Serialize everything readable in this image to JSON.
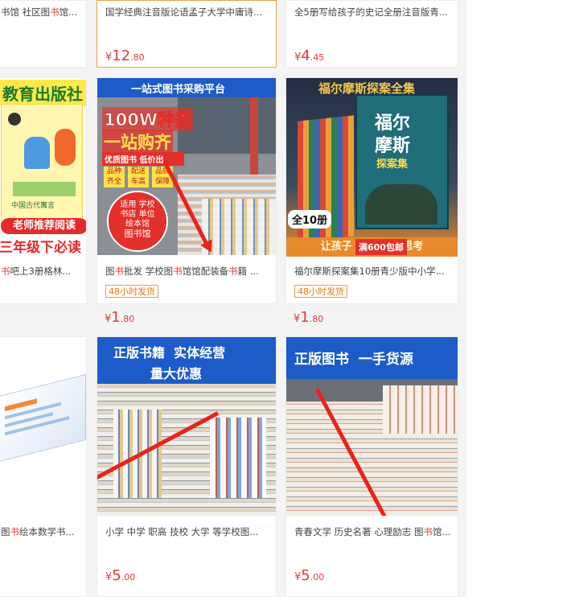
{
  "row1": {
    "left": {
      "title_pre": "书馆 社区图",
      "title_red": "书",
      "title_post": "馆..."
    },
    "mid": {
      "title": "国学经典注音版论语孟子大学中庸诗...",
      "price_yen": "¥",
      "price_int": "12",
      "price_dec": ".80"
    },
    "right": {
      "title": "全5册写给孩子的史记全册注音版青...",
      "price_yen": "¥",
      "price_int": "4",
      "price_dec": ".45"
    }
  },
  "row2": {
    "left": {
      "img_top": "教育出版社",
      "img_book": "中国古代寓言",
      "img_band1": "老师推荐阅读",
      "img_band2": "三年级下必读",
      "title_red": "书",
      "title_post": "吧上3册格林..."
    },
    "mid": {
      "img_banner": "一站式图书采购平台",
      "img_big1": "100W种类",
      "img_big2": "一站购齐",
      "img_sub": "优质图书 低价出",
      "img_tag1": "品种齐全",
      "img_tag2": "配送车高",
      "img_tag3": "品质保障",
      "img_circle1": "适用 学校",
      "img_circle2": "书店 单位",
      "img_circle3": "绘本馆",
      "img_circle4": "图书馆",
      "title_p1": "图",
      "title_r1": "书",
      "title_p2": "批发 学校图",
      "title_r2": "书",
      "title_p3": "馆馆配装备",
      "title_r3": "书",
      "title_p4": "籍 ...",
      "badge": "48小时发货",
      "price_yen": "¥",
      "price_int": "1",
      "price_dec": ".80"
    },
    "right": {
      "img_banner": "福尔摩斯探案全集",
      "img_cover1": "福尔",
      "img_cover2": "摩斯",
      "img_cover3": "探案集",
      "img_count": "全10册",
      "img_ship": "满600包邮",
      "img_slogan": "让孩子           样思考",
      "title": "福尔摩斯探案集10册青少版中小学...",
      "badge": "48小时发货",
      "price_yen": "¥",
      "price_int": "1",
      "price_dec": ".80"
    }
  },
  "row3": {
    "left": {
      "title_pre": "图",
      "title_red": "书",
      "title_post": "绘本数学书..."
    },
    "mid": {
      "img_line1": "正版书籍  实体经营",
      "img_line2": "量大优惠",
      "title": "小学 中学 职高 技校 大学 等学校图...",
      "price_yen": "¥",
      "price_int": "5",
      "price_dec": ".00"
    },
    "right": {
      "img_line1": "正版图书  一手货源",
      "title_pre": "青春文学 历史名著 心理励志 图",
      "title_red": "书",
      "title_post": "馆...",
      "price_yen": "¥",
      "price_int": "5",
      "price_dec": ".00"
    }
  },
  "colors": {
    "price_red": "#e4393c",
    "badge_orange": "#e07a10",
    "banner_blue": "#1d5bc8",
    "arrow_red": "#e8231b"
  }
}
